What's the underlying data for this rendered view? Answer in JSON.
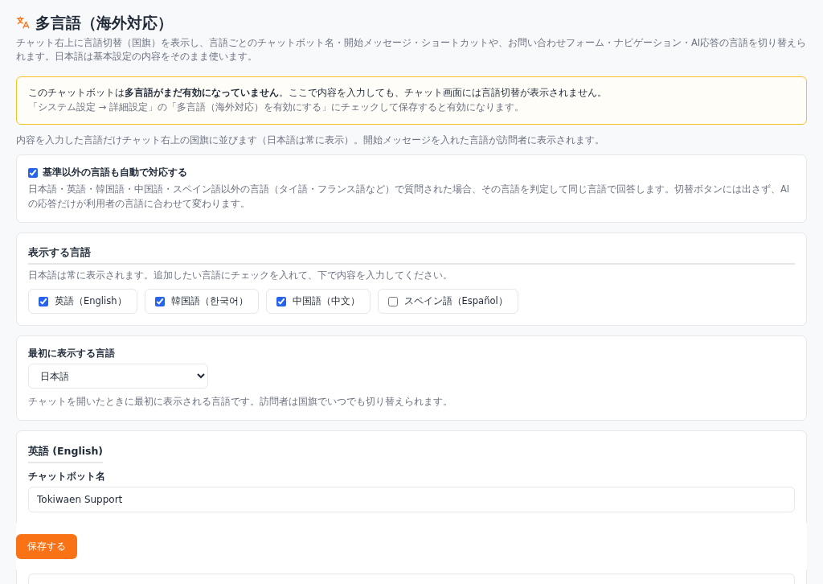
{
  "page": {
    "title": "多言語（海外対応）",
    "description": "チャット右上に言語切替（国旗）を表示し、言語ごとのチャットボット名・開始メッセージ・ショートカットや、お問い合わせフォーム・ナビゲーション・AI応答の言語を切り替えられます。日本語は基本設定の内容をそのまま使います。"
  },
  "warning": {
    "lines": [
      "このチャットボットは**多言語がまだ有効になっていません**。ここで内容を入力しても、チャット画面には言語切替が表示されません。",
      "「システム設定 → 詳細設定」の「多言語（海外対応）を有効にする」にチェックして保存すると有効になります。"
    ]
  },
  "note": "内容を入力した言語だけチャット右上の国旗に並びます（日本語は常に表示）。開始メッセージを入れた言語が訪問者に表示されます。",
  "auto_language": {
    "label": "基準以外の言語も自動で対応する",
    "checked": true,
    "help": "日本語・英語・韓国語・中国語・スペイン語以外の言語（タイ語・フランス語など）で質問された場合、その言語を判定して同じ言語で回答します。切替ボタンには出さず、AIの応答だけが利用者の言語に合わせて変わります。"
  },
  "display_languages": {
    "heading": "表示する言語",
    "help": "日本語は常に表示されます。追加したい言語にチェックを入れて、下で内容を入力してください。",
    "options": [
      {
        "label": "英語（English）",
        "checked": true
      },
      {
        "label": "韓国語（한국어）",
        "checked": true
      },
      {
        "label": "中国語（中文）",
        "checked": true
      },
      {
        "label": "スペイン語（Español）",
        "checked": false
      }
    ]
  },
  "initial_language": {
    "label": "最初に表示する言語",
    "value": "日本語",
    "help": "チャットを開いたときに最初に表示される言語です。訪問者は国旗でいつでも切り替えられます。"
  },
  "english_section": {
    "heading": "英語 (English)",
    "fields": [
      {
        "label": "チャットボット名",
        "value": "Tokiwaen Support"
      }
    ]
  },
  "save_button": {
    "label": "保存する"
  }
}
